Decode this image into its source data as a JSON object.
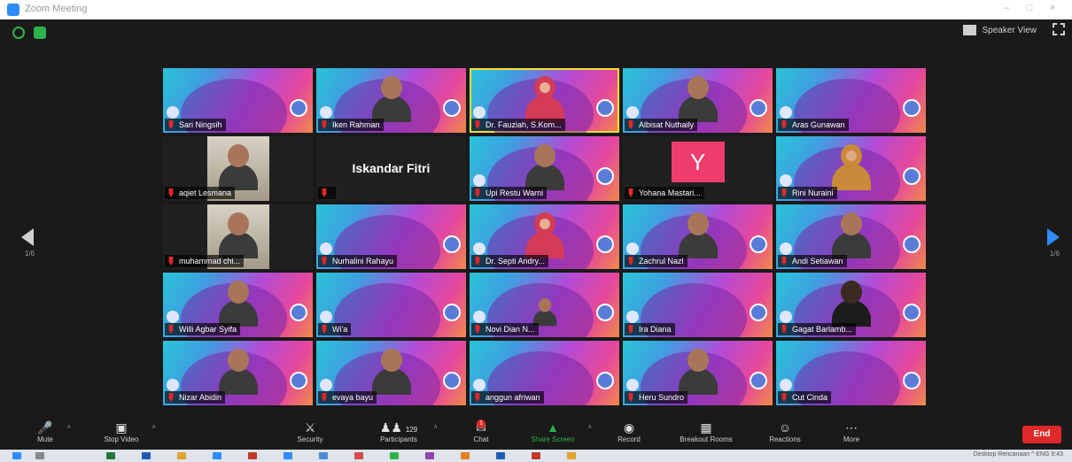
{
  "window": {
    "title": "Zoom Meeting",
    "controls": [
      "–",
      "□",
      "×"
    ]
  },
  "header": {
    "speaker_view_label": "Speaker View"
  },
  "pagination": {
    "left_label": "1/6",
    "right_label": "1/6"
  },
  "participants": [
    {
      "name": "Sari Ningsih",
      "kind": "promo"
    },
    {
      "name": "Iken Rahman",
      "kind": "promo-person"
    },
    {
      "name": "Dr. Fauziah, S.Kom...",
      "kind": "promo-hijab",
      "active": true
    },
    {
      "name": "Albisat Nuthaily",
      "kind": "promo-person"
    },
    {
      "name": "Aras Gunawan",
      "kind": "promo"
    },
    {
      "name": "aqiet Lesmana",
      "kind": "webcam"
    },
    {
      "name": "",
      "kind": "name-only",
      "display_text": "Iskandar Fitri"
    },
    {
      "name": "Upi Restu Warni",
      "kind": "promo-person"
    },
    {
      "name": "Yohana Mastari...",
      "kind": "avatar",
      "avatar_letter": "Y"
    },
    {
      "name": "Rini Nuraini",
      "kind": "promo-hijab2"
    },
    {
      "name": "muhammad chi...",
      "kind": "webcam"
    },
    {
      "name": "Nurhalini Rahayu",
      "kind": "promo"
    },
    {
      "name": "Dr. Septi Andry...",
      "kind": "promo-hijab"
    },
    {
      "name": "Zachrul Nazl",
      "kind": "promo-person"
    },
    {
      "name": "Andi Setiawan",
      "kind": "promo-person"
    },
    {
      "name": "Willi Agbar Syifa",
      "kind": "promo-person"
    },
    {
      "name": "Wi'a",
      "kind": "promo"
    },
    {
      "name": "Novi Dian N...",
      "kind": "promo-small"
    },
    {
      "name": "Ira Diana",
      "kind": "promo"
    },
    {
      "name": "Gagat Barlamb...",
      "kind": "promo-dark"
    },
    {
      "name": "Nizar Abidin",
      "kind": "promo-person"
    },
    {
      "name": "evaya bayu",
      "kind": "promo-person"
    },
    {
      "name": "anggun afriwan",
      "kind": "promo"
    },
    {
      "name": "Heru Sundro",
      "kind": "promo-person"
    },
    {
      "name": "Cut Cinda",
      "kind": "promo"
    }
  ],
  "toolbar": {
    "mute": "Mute",
    "stop_video": "Stop Video",
    "security": "Security",
    "participants": "Participants",
    "participants_count": "129",
    "chat": "Chat",
    "chat_badge": "1",
    "share_screen": "Share Screen",
    "record": "Record",
    "breakout_rooms": "Breakout Rooms",
    "reactions": "Reactions",
    "more": "More",
    "end": "End"
  },
  "taskbar": {
    "tray_text": "Desktop  Rencanaan  ^  ENG  9:43"
  },
  "colors": {
    "accent": "#2d8cff",
    "end": "#e02828",
    "share": "#2fb24c",
    "active_speaker": "#f5e02c"
  }
}
